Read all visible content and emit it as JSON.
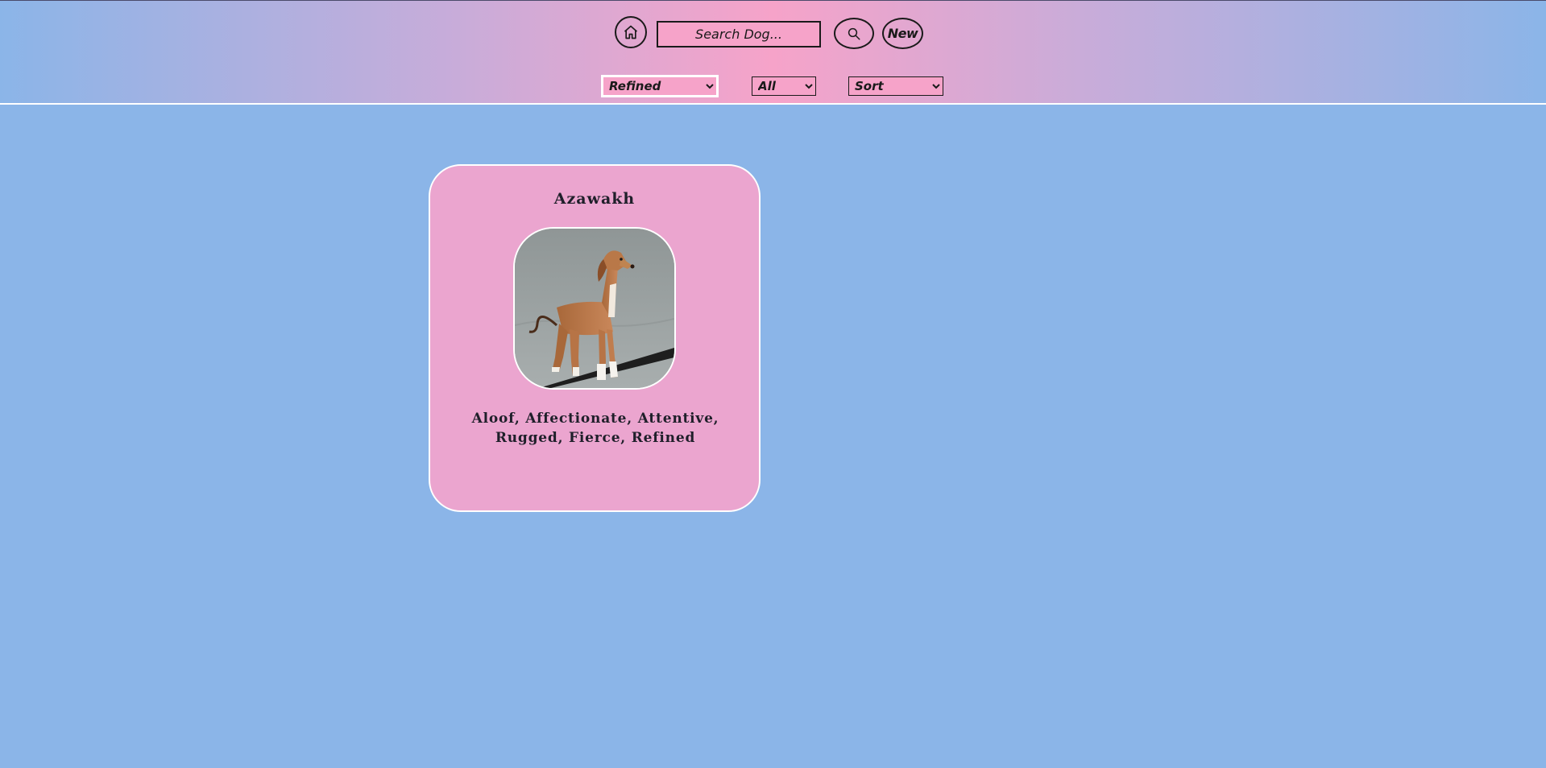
{
  "header": {
    "search": {
      "placeholder": "Search Dog...",
      "value": ""
    },
    "new_label": "New",
    "filters": {
      "temperament": {
        "selected": "Refined",
        "options": [
          "Refined"
        ]
      },
      "origin": {
        "selected": "All",
        "options": [
          "All"
        ]
      },
      "sort": {
        "selected": "Sort",
        "options": [
          "Sort"
        ]
      }
    },
    "icons": {
      "home": "home-icon",
      "search": "search-icon"
    }
  },
  "cards": [
    {
      "name": "Azawakh",
      "temperament": "Aloof, Affectionate, Attentive, Rugged, Fierce, Refined",
      "image_alt": "Azawakh dog photo"
    }
  ],
  "colors": {
    "background": "#8bb5e8",
    "header_gradient_center": "#f6a3c9",
    "card_background": "#eba5cf",
    "text": "#1f1f2a",
    "border_light": "#ffffff"
  }
}
